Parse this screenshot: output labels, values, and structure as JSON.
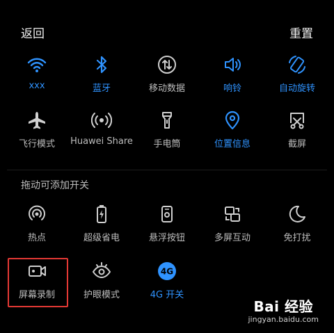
{
  "header": {
    "back": "返回",
    "reset": "重置"
  },
  "active_tiles": [
    {
      "label": "xxx",
      "icon": "wifi-icon",
      "state": "on"
    },
    {
      "label": "蓝牙",
      "icon": "bluetooth-icon",
      "state": "on"
    },
    {
      "label": "移动数据",
      "icon": "mobile-data-icon",
      "state": "off"
    },
    {
      "label": "响铃",
      "icon": "ring-icon",
      "state": "on"
    },
    {
      "label": "自动旋转",
      "icon": "auto-rotate-icon",
      "state": "on"
    },
    {
      "label": "飞行模式",
      "icon": "airplane-icon",
      "state": "off"
    },
    {
      "label": "Huawei Share",
      "icon": "huawei-share-icon",
      "state": "off"
    },
    {
      "label": "手电筒",
      "icon": "flashlight-icon",
      "state": "off"
    },
    {
      "label": "位置信息",
      "icon": "location-icon",
      "state": "on"
    },
    {
      "label": "截屏",
      "icon": "screenshot-icon",
      "state": "off"
    }
  ],
  "section": {
    "title": "拖动可添加开关"
  },
  "more_tiles": [
    {
      "label": "热点",
      "icon": "hotspot-icon",
      "state": "off"
    },
    {
      "label": "超级省电",
      "icon": "power-saving-icon",
      "state": "off"
    },
    {
      "label": "悬浮按钮",
      "icon": "floating-button-icon",
      "state": "off"
    },
    {
      "label": "多屏互动",
      "icon": "multi-screen-icon",
      "state": "off"
    },
    {
      "label": "免打扰",
      "icon": "do-not-disturb-icon",
      "state": "off"
    },
    {
      "label": "屏幕录制",
      "icon": "screen-record-icon",
      "state": "off"
    },
    {
      "label": "护眼模式",
      "icon": "eye-comfort-icon",
      "state": "off"
    },
    {
      "label": "4G 开关",
      "icon": "4g-icon",
      "state": "on"
    }
  ],
  "watermark": {
    "brand": "Bai 经验",
    "url": "jingyan.baidu.com"
  },
  "colors": {
    "accent": "#2f93ff",
    "icon_off": "#d0d0d0",
    "highlight": "#e53935",
    "background": "#000000"
  }
}
